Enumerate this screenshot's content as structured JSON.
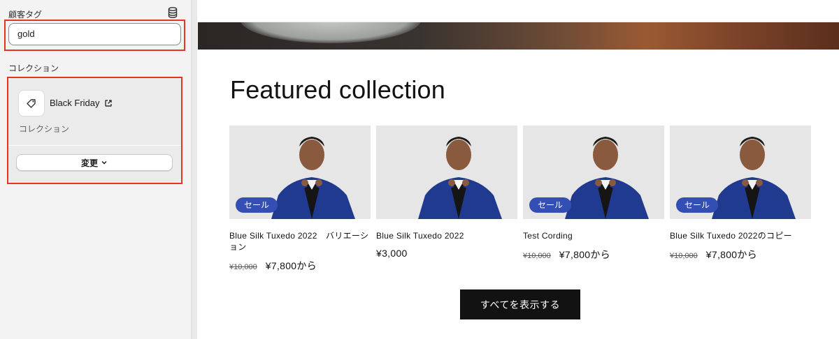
{
  "panel": {
    "customer_tag_label": "顧客タグ",
    "customer_tag_value": "gold",
    "collection_label": "コレクション",
    "collection": {
      "name": "Black Friday",
      "type_label": "コレクション",
      "change_label": "変更"
    }
  },
  "preview": {
    "section_title": "Featured collection",
    "products": [
      {
        "title": "Blue Silk Tuxedo 2022　バリエーション",
        "compare_price": "¥10,000",
        "price": "¥7,800から",
        "badge": "セール"
      },
      {
        "title": "Blue Silk Tuxedo 2022",
        "compare_price": "",
        "price": "¥3,000",
        "badge": ""
      },
      {
        "title": "Test Cording",
        "compare_price": "¥10,000",
        "price": "¥7,800から",
        "badge": "セール"
      },
      {
        "title": "Blue Silk Tuxedo 2022のコピー",
        "compare_price": "¥10,000",
        "price": "¥7,800から",
        "badge": "セール"
      }
    ],
    "view_all_label": "すべてを表示する"
  },
  "colors": {
    "highlight": "#e5371f",
    "badge": "#334fb4",
    "button_dark": "#121212"
  },
  "icons": [
    "database-icon",
    "tag-icon",
    "external-link-icon",
    "chevron-down-icon"
  ]
}
